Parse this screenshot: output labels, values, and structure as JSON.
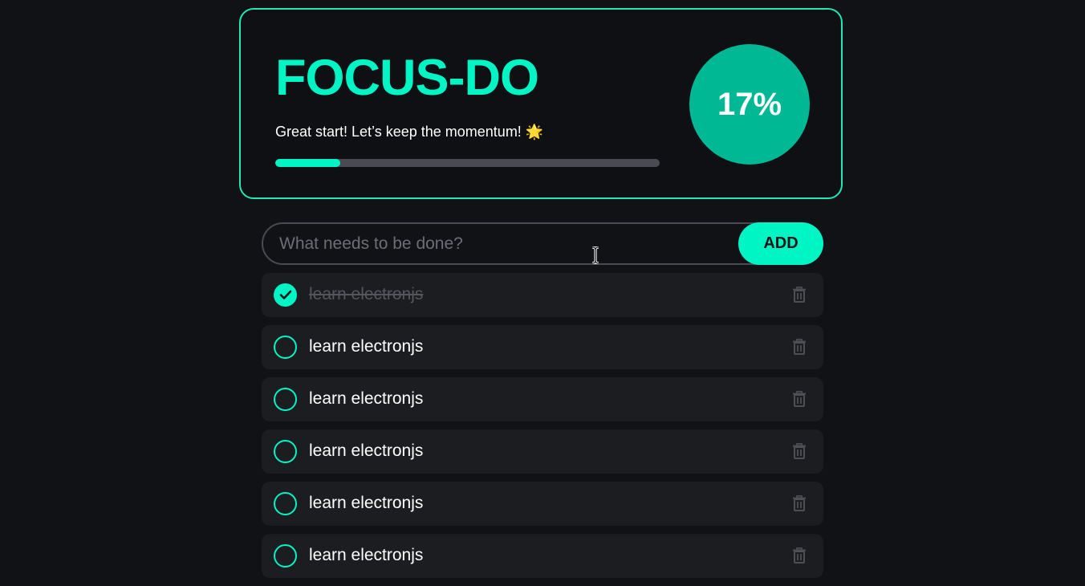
{
  "header": {
    "title": "FOCUS-DO",
    "motivation": "Great start! Let’s keep the momentum! 🌟",
    "progress_fraction": 0.17,
    "percent_label": "17%"
  },
  "form": {
    "placeholder": "What needs to be done?",
    "add_label": "ADD"
  },
  "tasks": [
    {
      "text": "learn electronjs",
      "done": true
    },
    {
      "text": "learn electronjs",
      "done": false
    },
    {
      "text": "learn electronjs",
      "done": false
    },
    {
      "text": "learn electronjs",
      "done": false
    },
    {
      "text": "learn electronjs",
      "done": false
    },
    {
      "text": "learn electronjs",
      "done": false
    }
  ],
  "icons": {
    "check": "check-icon",
    "delete": "trash-icon",
    "cursor": "text-cursor-icon"
  },
  "colors": {
    "accent": "#00f5c4",
    "accent_dark": "#00b894",
    "background": "#111216",
    "card": "#1c1d21",
    "muted": "#55565c"
  }
}
